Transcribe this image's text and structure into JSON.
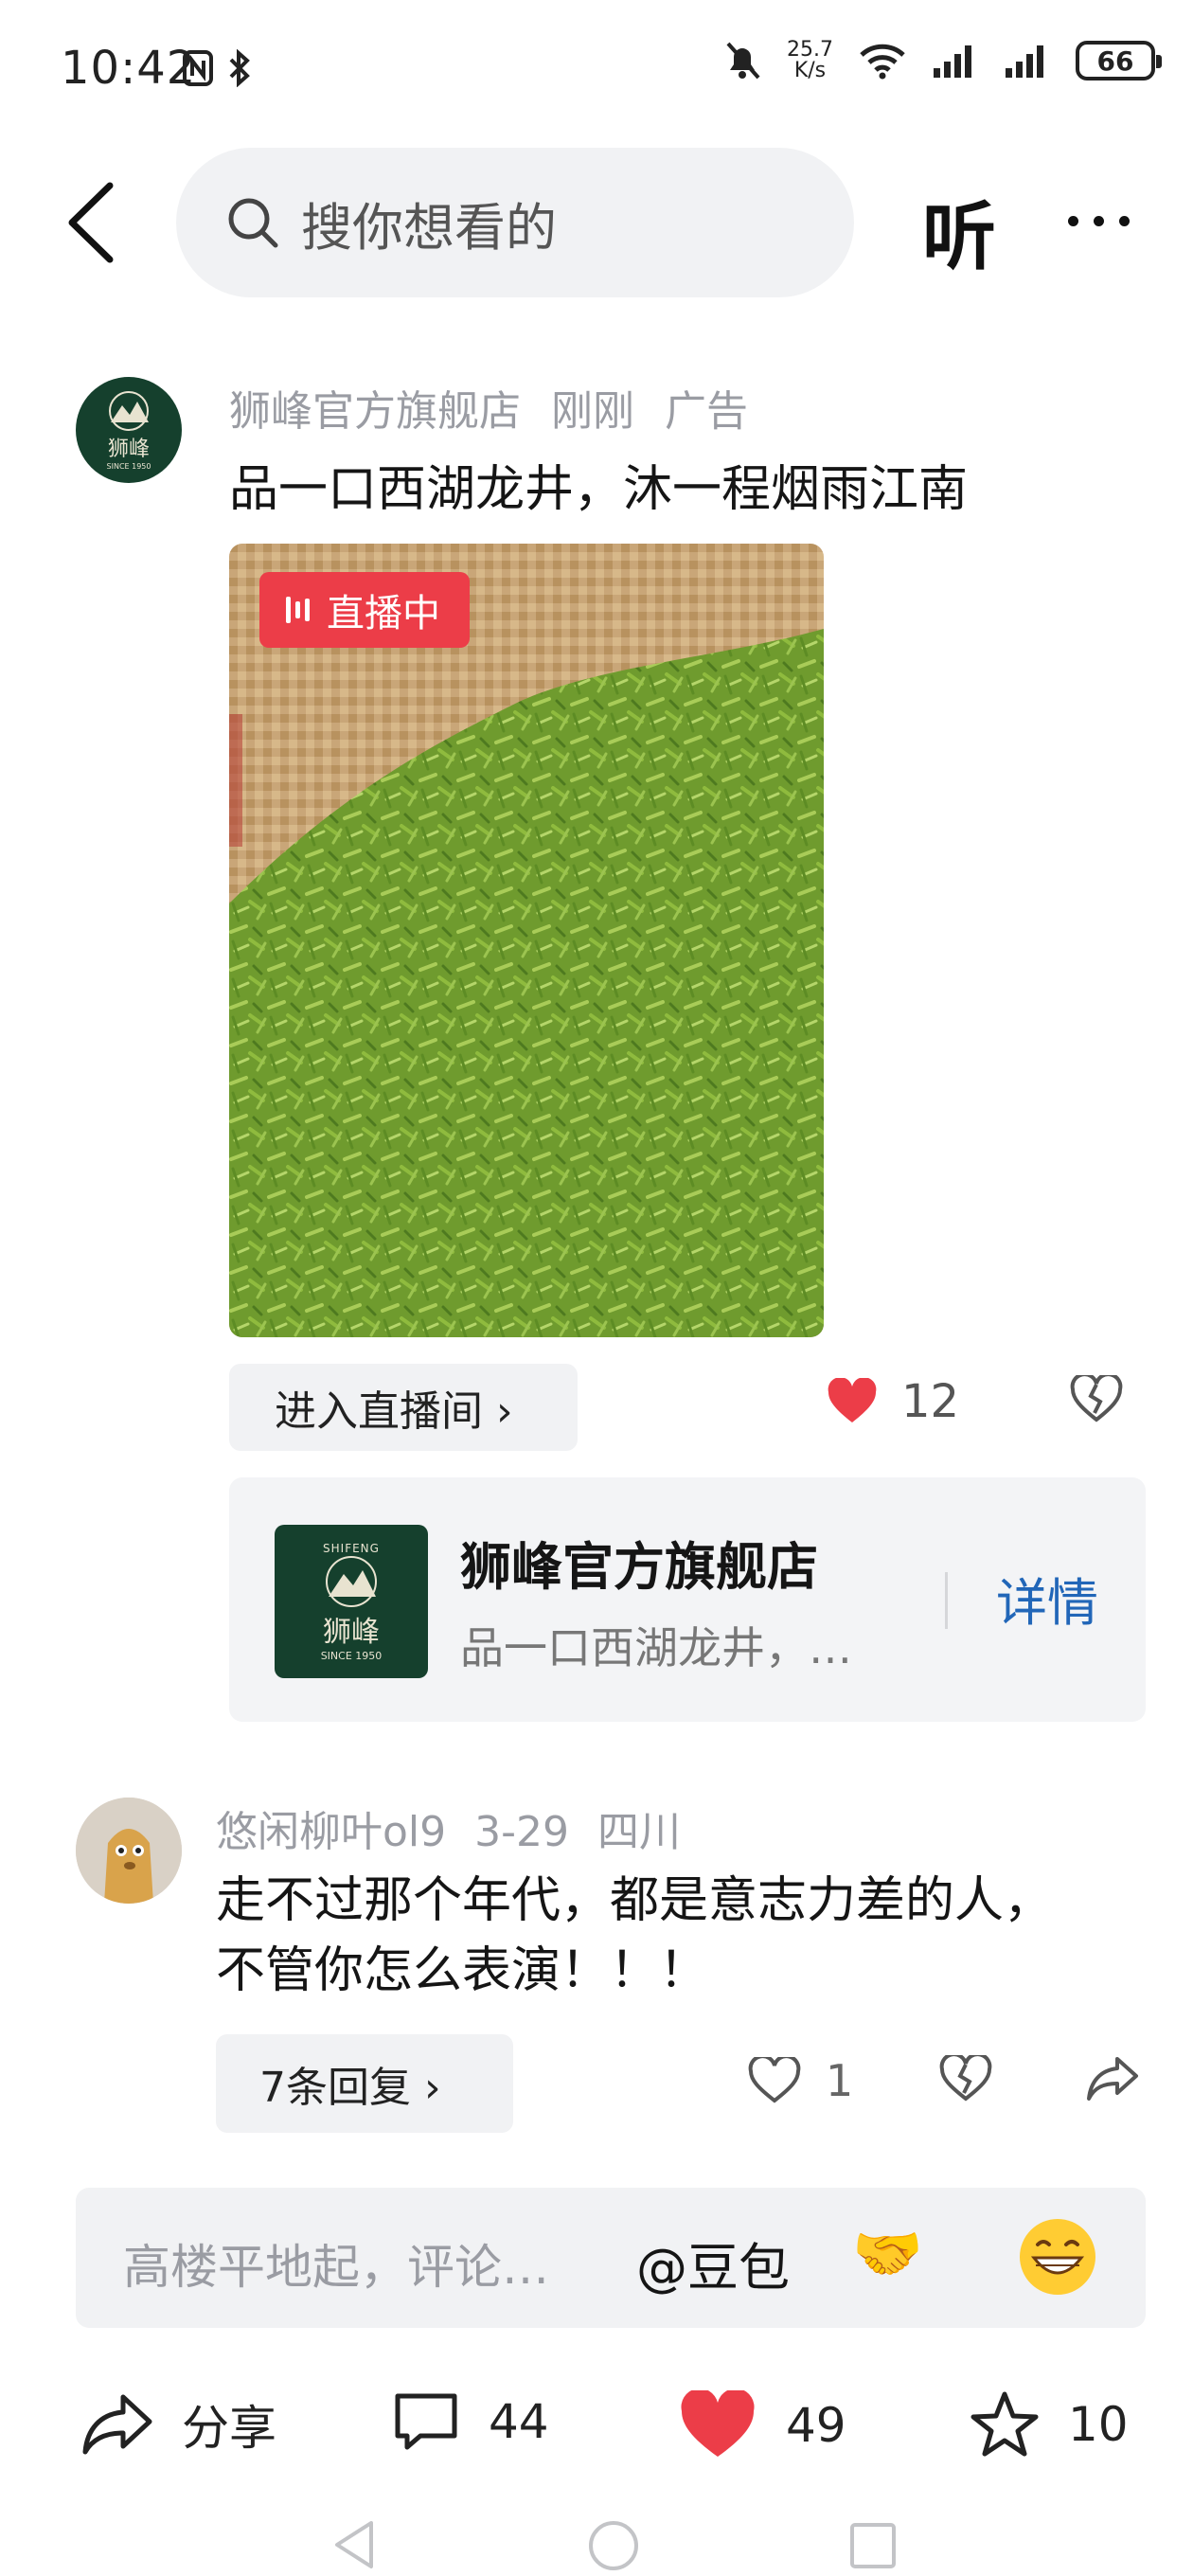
{
  "status_bar": {
    "time": "10:42",
    "net_speed_value": "25.7",
    "net_speed_unit": "K/s",
    "battery": "66"
  },
  "nav": {
    "search_placeholder": "搜你想看的",
    "listen_label": "听"
  },
  "ad_post": {
    "author": "狮峰官方旗舰店",
    "time": "刚刚",
    "tag": "广告",
    "title": "品一口西湖龙井，沐一程烟雨江南",
    "live_badge": "直播中",
    "enter_live_label": "进入直播间 ›",
    "like_count": "12",
    "avatar_text": "狮峰",
    "avatar_sub": "SINCE 1950"
  },
  "shop_card": {
    "name": "狮峰官方旗舰店",
    "description": "品一口西湖龙井，…",
    "detail_label": "详情",
    "logo_top": "SHIFENG",
    "logo_text": "狮峰",
    "logo_since": "SINCE 1950"
  },
  "comment": {
    "user": "悠闲柳叶ol9",
    "date": "3-29",
    "location": "四川",
    "text_line1": "走不过那个年代，都是意志力差的人，",
    "text_line2": "不管你怎么表演！！！",
    "replies_label": "7条回复 ›",
    "like_count": "1"
  },
  "comment_input": {
    "placeholder": "高楼平地起，评论…",
    "mention": "@豆包",
    "emoji_handshake": "🤝"
  },
  "action_bar": {
    "share_label": "分享",
    "comment_count": "44",
    "like_count": "49",
    "favorite_count": "10"
  },
  "colors": {
    "accent_red": "#ec3d48",
    "link_blue": "#2166b8",
    "brand_green": "#15402d"
  }
}
